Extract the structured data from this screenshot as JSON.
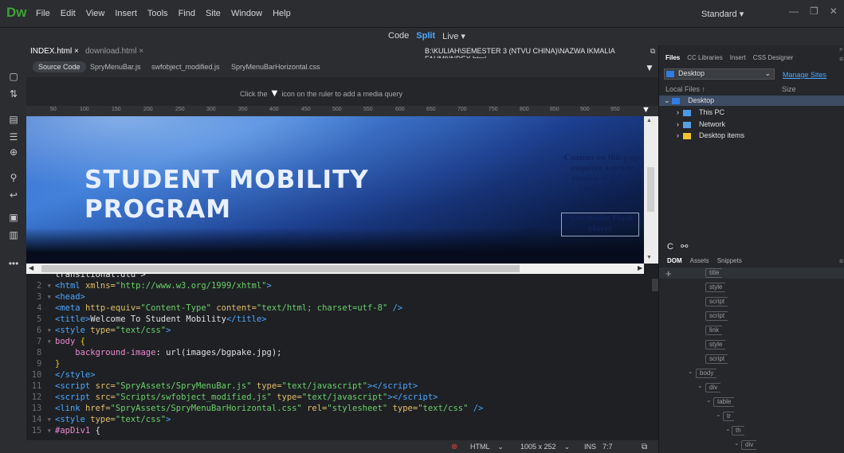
{
  "app": {
    "logo": "Dw",
    "workspace": "Standard",
    "workspace_chevron": "▾"
  },
  "menu": [
    "File",
    "Edit",
    "View",
    "Insert",
    "Tools",
    "Find",
    "Site",
    "Window",
    "Help"
  ],
  "views": {
    "code": "Code",
    "split": "Split",
    "live": "Live",
    "live_chevron": "▾"
  },
  "doc_tabs": [
    {
      "label": "INDEX.html",
      "close": "×"
    },
    {
      "label": "download.html",
      "close": "×"
    }
  ],
  "doc_path": "B:\\KULIAH\\SEMESTER 3 (NTVU CHINA)\\NAZWA IKMALIA FAHMI\\INDEX.html",
  "related_files": [
    "Source Code",
    "SpryMenuBar.js",
    "swfobject_modified.js",
    "SpryMenuBarHorizontal.css"
  ],
  "media_query": {
    "before": "Click the",
    "after": "icon on the ruler to add a media query"
  },
  "ruler_ticks": [
    "50",
    "100",
    "150",
    "200",
    "250",
    "300",
    "350",
    "400",
    "450",
    "500",
    "550",
    "600",
    "650",
    "700",
    "750",
    "800",
    "850",
    "900",
    "950"
  ],
  "design": {
    "banner_line1": "STUDENT MOBILITY",
    "banner_line2": "PROGRAM",
    "flash_message": "Content on this page requires a newer version of Adobe Flash Player.",
    "flash_link": "Get Adobe Flash player"
  },
  "code_lines": [
    {
      "n": "",
      "html": "<span class='txt'>transitional.dtd\"></span>"
    },
    {
      "n": "2",
      "fold": true,
      "html": "<span class='tag'>&lt;html</span> <span class='attr'>xmlns=</span><span class='str'>\"http://www.w3.org/1999/xhtml\"</span><span class='tag'>&gt;</span>"
    },
    {
      "n": "3",
      "fold": true,
      "html": "<span class='tag'>&lt;head&gt;</span>"
    },
    {
      "n": "4",
      "html": "<span class='tag'>&lt;meta</span> <span class='attr'>http-equiv=</span><span class='str'>\"Content-Type\"</span> <span class='attr'>content=</span><span class='str'>\"text/html; charset=utf-8\"</span> <span class='tag'>/&gt;</span>"
    },
    {
      "n": "5",
      "html": "<span class='tag'>&lt;title&gt;</span><span class='txt'>Welcome To Student Mobility</span><span class='tag'>&lt;/title&gt;</span>"
    },
    {
      "n": "6",
      "fold": true,
      "html": "<span class='tag'>&lt;style</span> <span class='attr'>type=</span><span class='str'>\"text/css\"</span><span class='tag'>&gt;</span>"
    },
    {
      "n": "7",
      "fold": true,
      "html": "<span class='css'>body</span> <span class='brace'>{</span>"
    },
    {
      "n": "8",
      "html": "    <span class='css'>background-image</span><span class='txt'>: url(images/bgpake.jpg);</span>"
    },
    {
      "n": "9",
      "html": "<span class='brace'>}</span>"
    },
    {
      "n": "10",
      "html": "<span class='tag'>&lt;/style&gt;</span>"
    },
    {
      "n": "11",
      "html": "<span class='tag'>&lt;script</span> <span class='attr'>src=</span><span class='str'>\"SpryAssets/SpryMenuBar.js\"</span> <span class='attr'>type=</span><span class='str'>\"text/javascript\"</span><span class='tag'>&gt;&lt;/script&gt;</span>"
    },
    {
      "n": "12",
      "html": "<span class='tag'>&lt;script</span> <span class='attr'>src=</span><span class='str'>\"Scripts/swfobject_modified.js\"</span> <span class='attr'>type=</span><span class='str'>\"text/javascript\"</span><span class='tag'>&gt;&lt;/script&gt;</span>"
    },
    {
      "n": "13",
      "html": "<span class='tag'>&lt;link</span> <span class='attr'>href=</span><span class='str'>\"SpryAssets/SpryMenuBarHorizontal.css\"</span> <span class='attr'>rel=</span><span class='str'>\"stylesheet\"</span> <span class='attr'>type=</span><span class='str'>\"text/css\"</span> <span class='tag'>/&gt;</span>"
    },
    {
      "n": "14",
      "fold": true,
      "html": "<span class='tag'>&lt;style</span> <span class='attr'>type=</span><span class='str'>\"text/css\"</span><span class='tag'>&gt;</span>"
    },
    {
      "n": "15",
      "fold": true,
      "html": "<span class='css'>#apDiv1</span> <span class='txt'>{</span>"
    }
  ],
  "status": {
    "language": "HTML",
    "size": "1005 x 252",
    "mode": "INS",
    "position": "7:7"
  },
  "right_panel": {
    "tabs": [
      "Files",
      "CC Libraries",
      "Insert",
      "CSS Designer"
    ],
    "site": "Desktop",
    "manage_sites": "Manage Sites",
    "local_files": "Local Files",
    "local_files_arrow": "↑",
    "size_label": "Size",
    "tree": [
      {
        "label": "Desktop",
        "level": 0,
        "icon": "folder-blue-icon"
      },
      {
        "label": "This PC",
        "level": 1,
        "icon": "computer-icon"
      },
      {
        "label": "Network",
        "level": 1,
        "icon": "network-icon"
      },
      {
        "label": "Desktop items",
        "level": 1,
        "icon": "folder-yellow-icon"
      }
    ],
    "dom_tabs": [
      "DOM",
      "Assets",
      "Snippets"
    ],
    "dom_nodes": [
      {
        "label": "title",
        "level": 0
      },
      {
        "label": "style",
        "level": 0
      },
      {
        "label": "script",
        "level": 0
      },
      {
        "label": "script",
        "level": 0
      },
      {
        "label": "link",
        "level": 0
      },
      {
        "label": "style",
        "level": 0
      },
      {
        "label": "script",
        "level": 0
      },
      {
        "label": "body",
        "level": -1,
        "expanded": true
      },
      {
        "label": "div",
        "level": 0,
        "expanded": true
      },
      {
        "label": "table",
        "level": 1,
        "expanded": true
      },
      {
        "label": "tr",
        "level": 2,
        "expanded": true
      },
      {
        "label": "th",
        "level": 3,
        "expanded": true
      },
      {
        "label": "div",
        "level": 4,
        "expanded": true
      }
    ]
  },
  "colors": {
    "accent": "#4fa8ff",
    "logo": "#3fa238",
    "selection": "#3d4b63"
  }
}
